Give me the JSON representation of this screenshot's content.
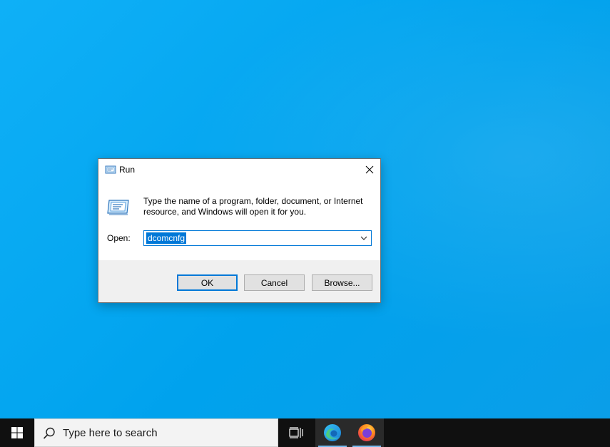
{
  "dialog": {
    "title": "Run",
    "description": "Type the name of a program, folder, document, or Internet resource, and Windows will open it for you.",
    "open_label": "Open:",
    "open_value": "dcomcnfg",
    "buttons": {
      "ok": "OK",
      "cancel": "Cancel",
      "browse": "Browse..."
    }
  },
  "taskbar": {
    "search_placeholder": "Type here to search",
    "items": [
      "task-view",
      "microsoft-edge",
      "firefox"
    ]
  },
  "colors": {
    "desktop": "#00a2ed",
    "accent": "#0078d7",
    "taskbar": "#101010"
  }
}
